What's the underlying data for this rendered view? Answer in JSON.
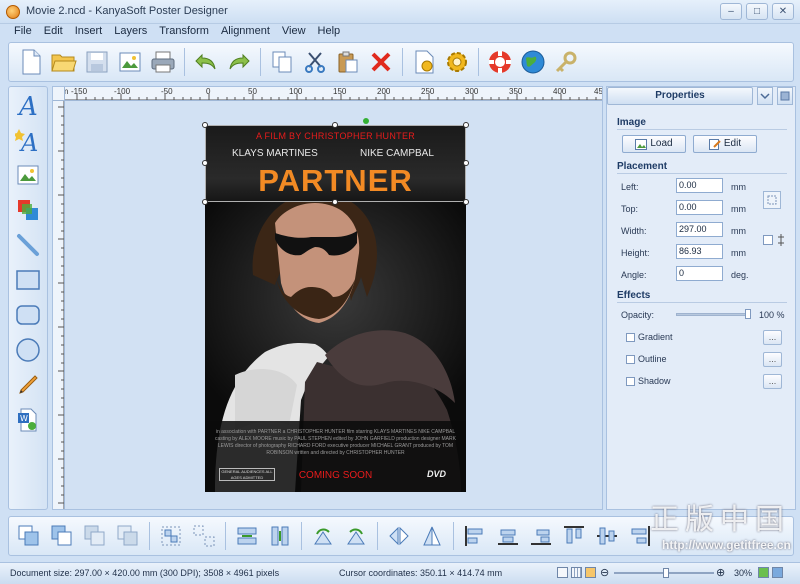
{
  "window": {
    "title": "Movie 2.ncd - KanyaSoft Poster Designer",
    "buttons": [
      "–",
      "□",
      "✕"
    ]
  },
  "menu": [
    "File",
    "Edit",
    "Insert",
    "Layers",
    "Transform",
    "Alignment",
    "View",
    "Help"
  ],
  "toolbar": {
    "icons": [
      "new-icon",
      "open-icon",
      "save-icon",
      "export-image-icon",
      "print-icon",
      "undo-icon",
      "redo-icon",
      "copy-icon",
      "cut-icon",
      "paste-icon",
      "delete-icon",
      "page-setup-icon",
      "settings-icon",
      "help-icon",
      "web-icon",
      "key-icon"
    ]
  },
  "left_tools": [
    "text-icon",
    "art-text-icon",
    "image-icon",
    "layers-icon",
    "line-icon",
    "rectangle-icon",
    "rounded-rectangle-icon",
    "ellipse-icon",
    "pencil-icon",
    "word-import-icon"
  ],
  "ruler": {
    "labels": [
      "mm",
      "-150",
      "-100",
      "-50",
      "0",
      "50",
      "100",
      "150",
      "200",
      "250",
      "300",
      "350",
      "400",
      "45"
    ]
  },
  "poster": {
    "credit": "A FILM BY CHRISTOPHER HUNTER",
    "actor_left": "KLAYS MARTINES",
    "actor_right": "NIKE CAMPBAL",
    "title": "PARTNER",
    "credits_block": "in association with PARTNER a CHRISTOPHER HUNTER film starring KLAYS MARTINES NIKE CAMPBAL casting by ALEX MOORE music by PAUL STEPHEN edited by JOHN GARFIELD production designer MARK LEWIS director of photography RICHARD FORD executive producer MICHAEL GRANT produced by TOM ROBINSON written and directed by CHRISTOPHER HUNTER",
    "coming_soon": "COMING SOON",
    "rating_box": "GENERAL AUDIENCES ALL AGES ADMITTED",
    "dvd": "DVD"
  },
  "properties": {
    "header": "Properties",
    "image_section": "Image",
    "load_label": "Load",
    "edit_label": "Edit",
    "placement_section": "Placement",
    "left_label": "Left:",
    "left_value": "0.00",
    "left_unit": "mm",
    "top_label": "Top:",
    "top_value": "0.00",
    "top_unit": "mm",
    "width_label": "Width:",
    "width_value": "297.00",
    "width_unit": "mm",
    "height_label": "Height:",
    "height_value": "86.93",
    "height_unit": "mm",
    "angle_label": "Angle:",
    "angle_value": "0",
    "angle_unit": "deg.",
    "effects_section": "Effects",
    "opacity_label": "Opacity:",
    "opacity_value": "100 %",
    "opacity_fraction": 1.0,
    "gradient_label": "Gradient",
    "outline_label": "Outline",
    "shadow_label": "Shadow",
    "dots": "..."
  },
  "bottom_toolbar": {
    "icons": [
      "bring-front-icon",
      "bring-forward-icon",
      "send-backward-icon",
      "send-back-icon",
      "group-icon",
      "ungroup-icon",
      "same-width-icon",
      "same-height-icon",
      "rotate-left-icon",
      "rotate-right-icon",
      "flip-horizontal-icon",
      "flip-vertical-icon",
      "align-left-icon",
      "align-center-icon",
      "align-right-icon",
      "align-top-icon",
      "align-middle-icon",
      "align-bottom-icon"
    ]
  },
  "status": {
    "document": "Document size: 297.00 × 420.00 mm (300 DPI); 3508 × 4961 pixels",
    "cursor": "Cursor coordinates: 350.11 × 414.74 mm",
    "zoom": "30%",
    "zoom_fraction": 0.52
  },
  "watermark": {
    "text": "正版中国",
    "url": "http://www.getitfree.cn"
  },
  "colors": {
    "accent": "#2f6fc0",
    "poster_title": "#f28a24",
    "poster_red": "#e81c1c",
    "panel": "#e3ecf8"
  }
}
